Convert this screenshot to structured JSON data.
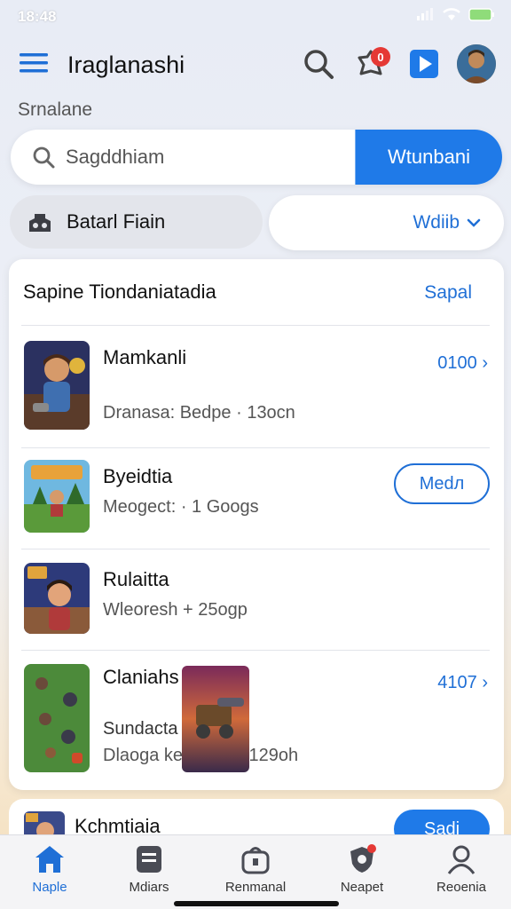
{
  "status_bar": {
    "time": "18:48"
  },
  "header": {
    "title": "Iraglanashi",
    "notification_count": "0",
    "icons": [
      "menu-icon",
      "search-icon",
      "bell-icon",
      "play-icon"
    ]
  },
  "section_label": "Srnalane",
  "search": {
    "placeholder": "Sagddhiam",
    "button_label": "Wtunbani"
  },
  "filters": {
    "left_label": "Batarl Fiain",
    "right_label": "Wdiib"
  },
  "list": {
    "title": "Sapine Tiondaniatadia",
    "action_label": "Sapal",
    "items": [
      {
        "name": "Mamkanli",
        "meta": "Dranasa: Bedpe · 13ocn",
        "value": "0100"
      },
      {
        "name": "Byeidtia",
        "meta": "Meogect: · 1 Googs",
        "button": "Medл"
      },
      {
        "name": "Rulaitta",
        "meta": "Wleoresh  + 25ogp"
      },
      {
        "name": "Claniahs",
        "sub": "Sundacta",
        "meta": "Dlaoga kensgingy 129oh",
        "value": "4107"
      }
    ]
  },
  "next_card": {
    "title": "Kchmtiaia",
    "button_label": "Sadi"
  },
  "bottom_nav": [
    {
      "label": "Naple",
      "icon": "home-icon"
    },
    {
      "label": "Mdiars",
      "icon": "document-icon"
    },
    {
      "label": "Renmanal",
      "icon": "bag-icon"
    },
    {
      "label": "Neapet",
      "icon": "shield-icon"
    },
    {
      "label": "Reoenia",
      "icon": "user-icon"
    }
  ],
  "colors": {
    "accent": "#1f7ae8",
    "badge": "#e53935"
  }
}
